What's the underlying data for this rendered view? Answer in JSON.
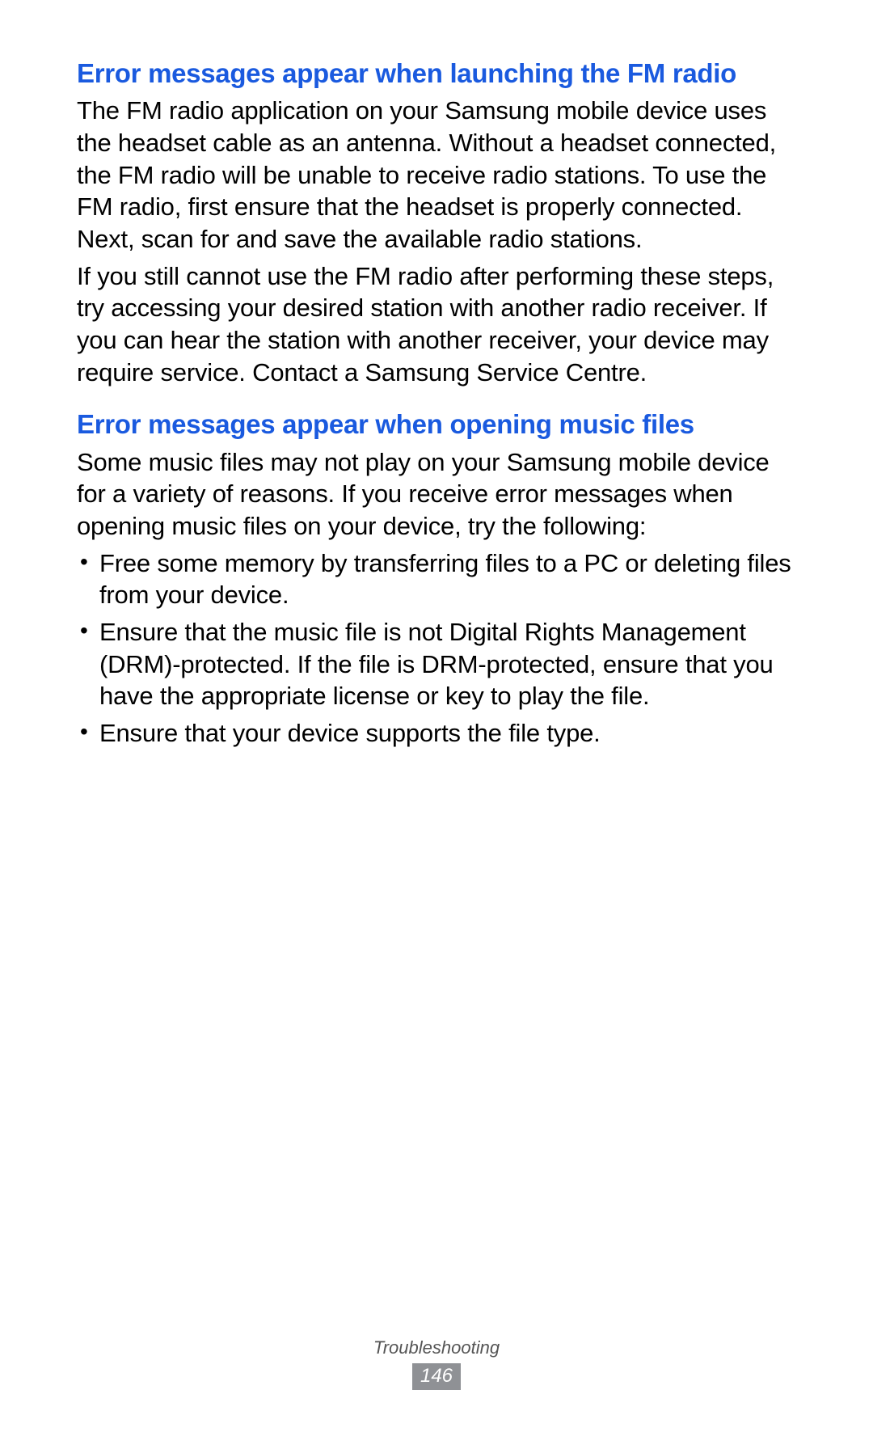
{
  "section1": {
    "heading": "Error messages appear when launching the FM radio",
    "para1": "The FM radio application on your Samsung mobile device uses the headset cable as an antenna. Without a headset connected, the FM radio will be unable to receive radio stations. To use the FM radio, first ensure that the headset is properly connected. Next, scan for and save the available radio stations.",
    "para2": "If you still cannot use the FM radio after performing these steps, try accessing your desired station with another radio receiver. If you can hear the station with another receiver, your device may require service. Contact a Samsung Service Centre."
  },
  "section2": {
    "heading": "Error messages appear when opening music files",
    "para1": "Some music files may not play on your Samsung mobile device for a variety of reasons. If you receive error messages when opening music files on your device, try the following:",
    "bullets": [
      "Free some memory by transferring files to a PC or deleting files from your device.",
      "Ensure that the music file is not Digital Rights Management (DRM)-protected. If the file is DRM-protected, ensure that you have the appropriate license or key to play the file.",
      "Ensure that your device supports the file type."
    ]
  },
  "footer": {
    "section_label": "Troubleshooting",
    "page_number": "146"
  }
}
